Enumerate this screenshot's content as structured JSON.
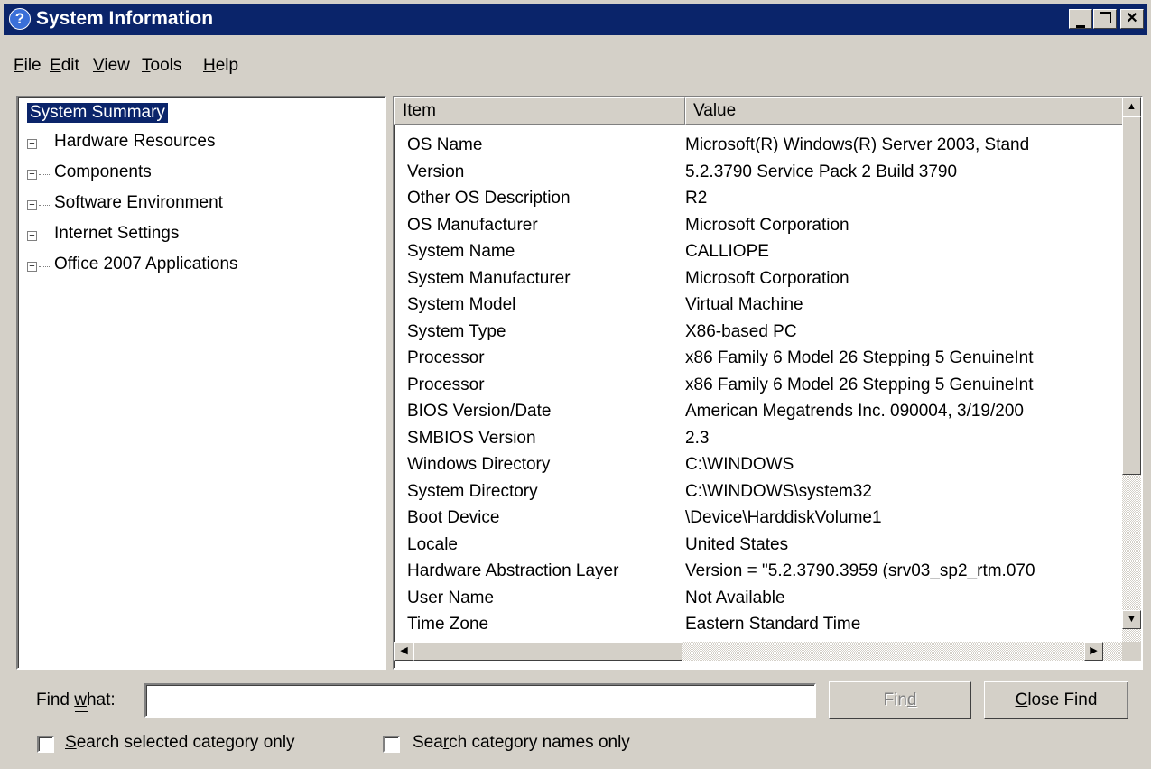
{
  "window": {
    "title": "System Information",
    "icon": "help-question-icon",
    "controls": [
      "minimize",
      "maximize",
      "close"
    ]
  },
  "menu": [
    {
      "label": "File",
      "access_key": "F"
    },
    {
      "label": "Edit",
      "access_key": "E"
    },
    {
      "label": "View",
      "access_key": "V"
    },
    {
      "label": "Tools",
      "access_key": "T"
    },
    {
      "label": "Help",
      "access_key": "H"
    }
  ],
  "tree": {
    "root": "System Summary",
    "children": [
      "Hardware Resources",
      "Components",
      "Software Environment",
      "Internet Settings",
      "Office 2007 Applications"
    ]
  },
  "list": {
    "columns": [
      "Item",
      "Value"
    ],
    "rows": [
      [
        "OS Name",
        "Microsoft(R) Windows(R) Server 2003, Stand"
      ],
      [
        "Version",
        "5.2.3790 Service Pack 2 Build 3790"
      ],
      [
        "Other OS Description",
        "R2"
      ],
      [
        "OS Manufacturer",
        "Microsoft Corporation"
      ],
      [
        "System Name",
        "CALLIOPE"
      ],
      [
        "System Manufacturer",
        "Microsoft Corporation"
      ],
      [
        "System Model",
        "Virtual Machine"
      ],
      [
        "System Type",
        "X86-based PC"
      ],
      [
        "Processor",
        "x86 Family 6 Model 26 Stepping 5 GenuineInt"
      ],
      [
        "Processor",
        "x86 Family 6 Model 26 Stepping 5 GenuineInt"
      ],
      [
        "BIOS Version/Date",
        "American Megatrends Inc. 090004, 3/19/200"
      ],
      [
        "SMBIOS Version",
        "2.3"
      ],
      [
        "Windows Directory",
        "C:\\WINDOWS"
      ],
      [
        "System Directory",
        "C:\\WINDOWS\\system32"
      ],
      [
        "Boot Device",
        "\\Device\\HarddiskVolume1"
      ],
      [
        "Locale",
        "United States"
      ],
      [
        "Hardware Abstraction Layer",
        "Version = \"5.2.3790.3959 (srv03_sp2_rtm.070"
      ],
      [
        "User Name",
        "Not Available"
      ],
      [
        "Time Zone",
        "Eastern Standard Time"
      ]
    ]
  },
  "find": {
    "label": "Find what:",
    "value": "",
    "find_button": "Find",
    "close_find_button": "Close Find",
    "option_selected_category": "Search selected category only",
    "option_category_names": "Search category names only",
    "option_selected_category_checked": false,
    "option_category_names_checked": false
  }
}
